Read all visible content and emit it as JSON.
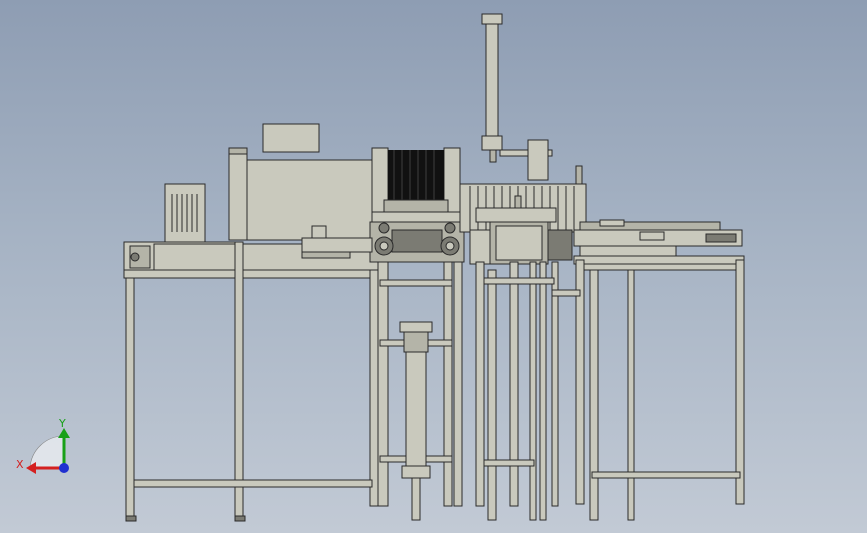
{
  "view": {
    "background_top": "#8e9db3",
    "background_bottom": "#c2cad5",
    "frame_color": "#c9c9bd",
    "line_color": "#2a2a2a"
  },
  "triad": {
    "x_label": "X",
    "y_label": "Y",
    "x_color": "#d42020",
    "y_color": "#18a018",
    "z_color": "#2030d0"
  }
}
